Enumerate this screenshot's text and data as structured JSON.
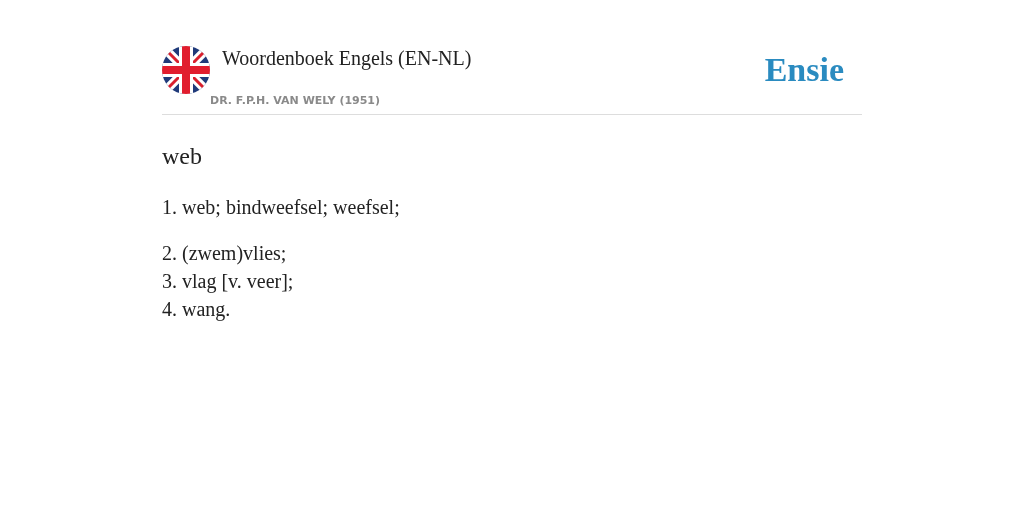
{
  "header": {
    "title": "Woordenboek Engels (EN-NL)",
    "author": "DR. F.P.H. VAN WELY (1951)",
    "brand": "Ensie"
  },
  "entry": {
    "headword": "web",
    "groups": [
      [
        {
          "number": "1.",
          "text": "web; bindweefsel; weefsel;"
        }
      ],
      [
        {
          "number": "2.",
          "text": "(zwem)vlies;"
        },
        {
          "number": "3.",
          "text": "vlag [v. veer];"
        },
        {
          "number": "4.",
          "text": "wang."
        }
      ]
    ]
  }
}
